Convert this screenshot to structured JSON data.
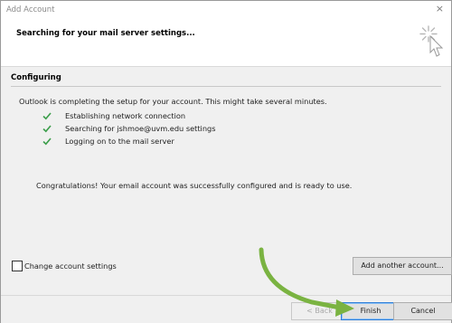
{
  "window": {
    "title": "Add Account",
    "close_label": "×"
  },
  "header": {
    "title": "Searching for your mail server settings..."
  },
  "section": {
    "title": "Configuring"
  },
  "intro": "Outlook is completing the setup for your account. This might take several minutes.",
  "steps": [
    {
      "label": "Establishing network connection",
      "status": "done"
    },
    {
      "label": "Searching for jshmoe@uvm.edu settings",
      "status": "done"
    },
    {
      "label": "Logging on to the mail server",
      "status": "done"
    }
  ],
  "congrats": "Congratulations! Your email account was successfully configured and is ready to use.",
  "change_settings": {
    "label": "Change account settings",
    "checked": false
  },
  "buttons": {
    "add_another": "Add another account...",
    "back": "< Back",
    "finish": "Finish",
    "cancel": "Cancel"
  },
  "colors": {
    "check": "#3c9e4b",
    "arrow": "#7ab341",
    "finish_border": "#2f7ed8"
  },
  "icons": {
    "header": "spinner-cursor-icon",
    "step": "checkmark-icon"
  }
}
